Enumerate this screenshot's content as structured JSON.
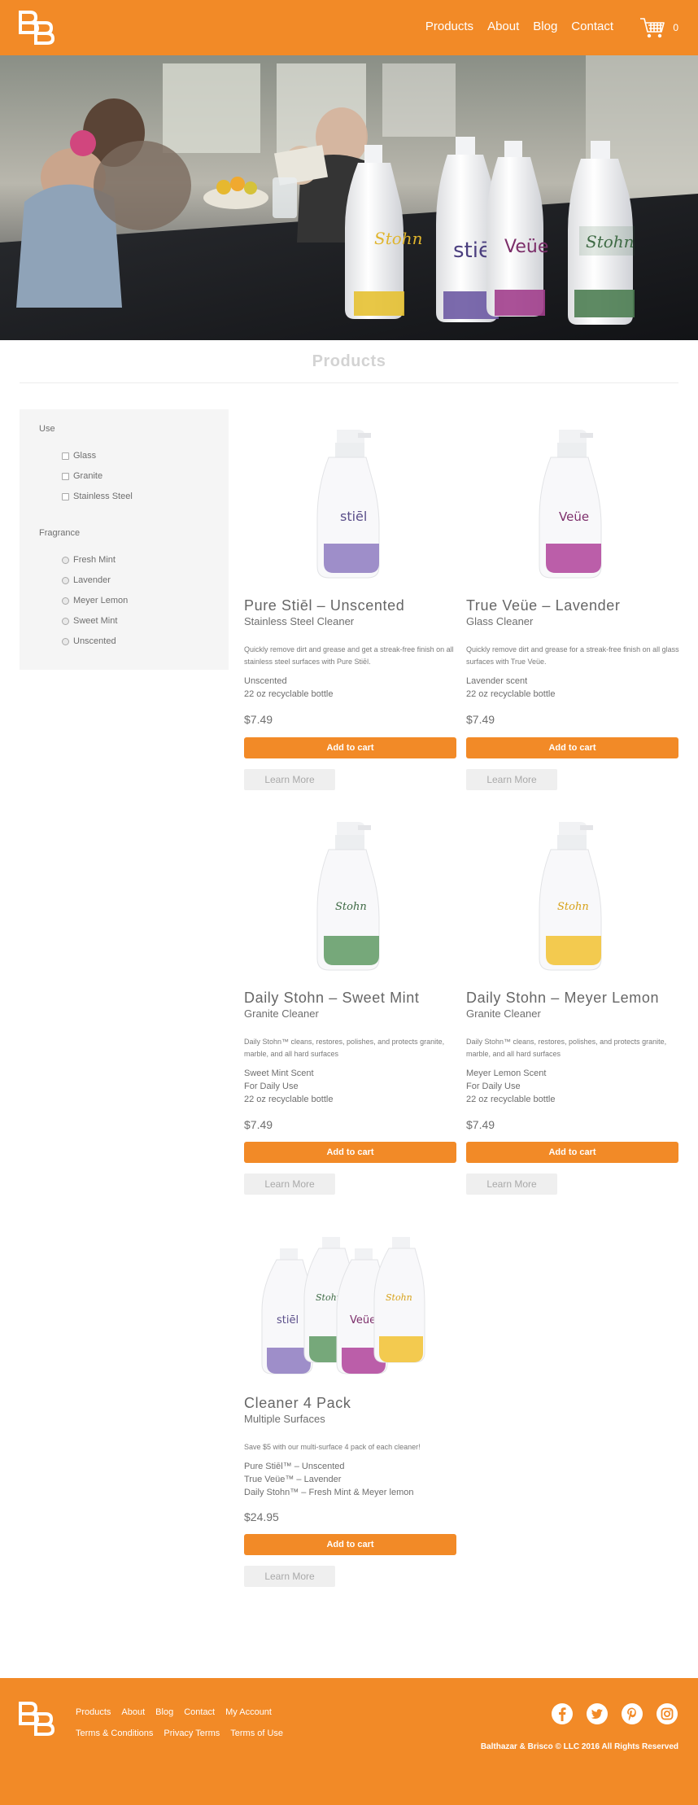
{
  "brand": {
    "accent": "#f28a27",
    "logo_icon": "b-and-b-logo-icon"
  },
  "nav": {
    "items": [
      {
        "label": "Products"
      },
      {
        "label": "About"
      },
      {
        "label": "Blog"
      },
      {
        "label": "Contact"
      }
    ],
    "cart_icon": "shopping-cart-icon",
    "cart_count": "0"
  },
  "hero": {
    "description": "photo-family-kitchen-cleaner-bottles"
  },
  "products_section": {
    "title": "Products"
  },
  "filters": {
    "use": {
      "heading": "Use",
      "options": [
        {
          "label": "Glass",
          "checked": false
        },
        {
          "label": "Granite",
          "checked": false
        },
        {
          "label": "Stainless Steel",
          "checked": false
        }
      ]
    },
    "fragrance": {
      "heading": "Fragrance",
      "options": [
        {
          "label": "Fresh Mint",
          "selected": false
        },
        {
          "label": "Lavender",
          "selected": false
        },
        {
          "label": "Meyer Lemon",
          "selected": false
        },
        {
          "label": "Sweet Mint",
          "selected": false
        },
        {
          "label": "Unscented",
          "selected": false
        }
      ]
    }
  },
  "products": [
    {
      "name": "Pure Stiēl – Unscented",
      "subtitle": "Stainless Steel Cleaner",
      "description": "Quickly remove dirt and grease and get a streak-free finish on all stainless steel surfaces with Pure Stiēl.",
      "details": [
        "Unscented",
        "22 oz recyclable bottle"
      ],
      "price": "$7.49",
      "add_label": "Add to cart",
      "more_label": "Learn More",
      "bottle_label": "stiēl",
      "label_color": "#5b4f8a",
      "accent_color": "#8e7bbf"
    },
    {
      "name": "True Veüe – Lavender",
      "subtitle": "Glass Cleaner",
      "description": "Quickly remove dirt and grease for a streak-free finish on all glass surfaces with True Veüe.",
      "details": [
        "Lavender scent",
        "22 oz recyclable bottle"
      ],
      "price": "$7.49",
      "add_label": "Add to cart",
      "more_label": "Learn More",
      "bottle_label": "Veüe",
      "label_color": "#7d2f6b",
      "accent_color": "#b0439a"
    },
    {
      "name": "Daily Stohn – Sweet Mint",
      "subtitle": "Granite Cleaner",
      "description": "Daily Stohn™ cleans, restores, polishes, and protects granite, marble, and all hard surfaces",
      "details": [
        "Sweet Mint Scent",
        "For Daily Use",
        "22 oz recyclable bottle"
      ],
      "price": "$7.49",
      "add_label": "Add to cart",
      "more_label": "Learn More",
      "bottle_label": "Stohn",
      "label_color": "#3f6b45",
      "accent_color": "#5f9a63"
    },
    {
      "name": "Daily Stohn – Meyer Lemon",
      "subtitle": "Granite Cleaner",
      "description": "Daily Stohn™ cleans, restores, polishes, and protects granite, marble, and all hard surfaces",
      "details": [
        "Meyer Lemon Scent",
        "For Daily Use",
        "22 oz recyclable bottle"
      ],
      "price": "$7.49",
      "add_label": "Add to cart",
      "more_label": "Learn More",
      "bottle_label": "Stohn",
      "label_color": "#d7a21a",
      "accent_color": "#f2c230"
    },
    {
      "name": "Cleaner 4 Pack",
      "subtitle": "Multiple Surfaces",
      "description": "Save $5 with our multi-surface 4 pack of each cleaner!",
      "details": [
        "Pure Stiēl™ – Unscented",
        "True Veüe™ – Lavender",
        "Daily Stohn™ – Fresh Mint & Meyer lemon"
      ],
      "price": "$24.95",
      "add_label": "Add to cart",
      "more_label": "Learn More"
    }
  ],
  "footer": {
    "links_row1": [
      {
        "label": "Products"
      },
      {
        "label": "About"
      },
      {
        "label": "Blog"
      },
      {
        "label": "Contact"
      },
      {
        "label": "My Account"
      }
    ],
    "links_row2": [
      {
        "label": "Terms & Conditions"
      },
      {
        "label": "Privacy Terms"
      },
      {
        "label": "Terms of Use"
      }
    ],
    "social_icons": [
      "facebook-icon",
      "twitter-icon",
      "pinterest-icon",
      "instagram-icon"
    ],
    "copyright": "Balthazar & Brisco © LLC  2016 All Rights Reserved"
  }
}
